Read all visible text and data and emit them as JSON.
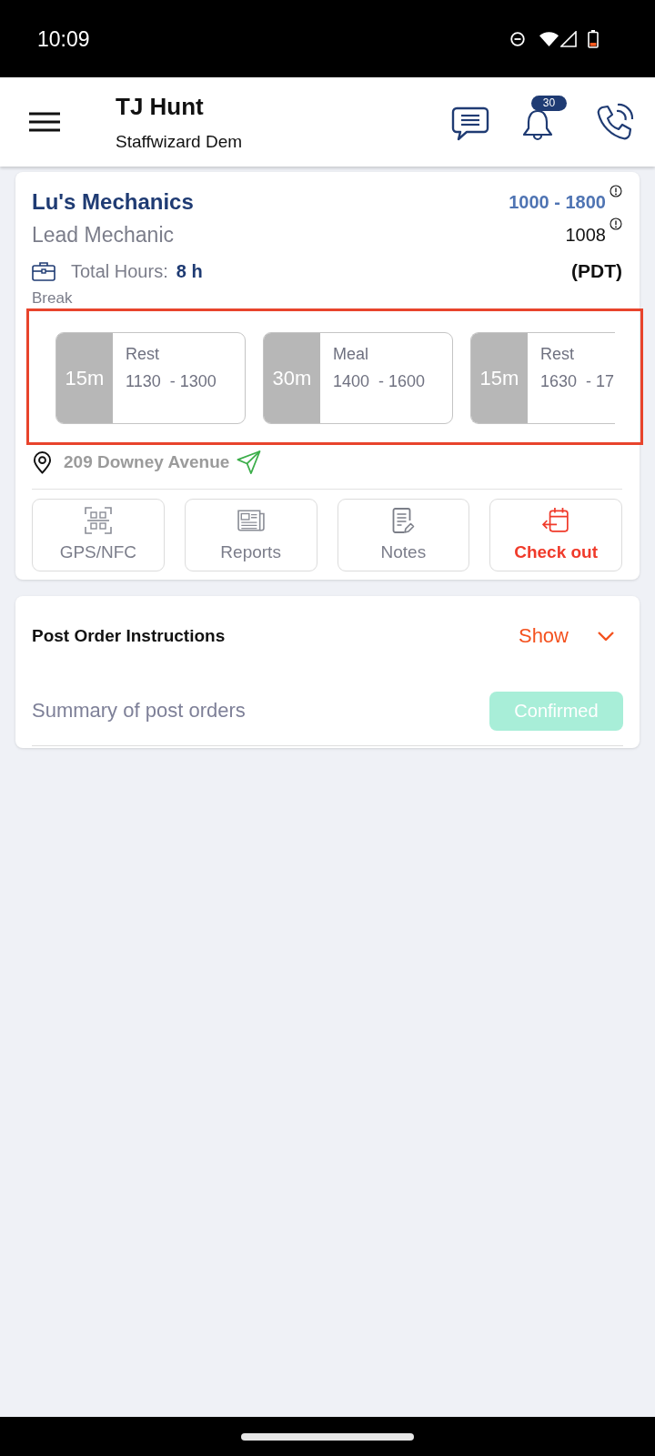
{
  "status_bar": {
    "time": "10:09"
  },
  "header": {
    "title": "TJ Hunt",
    "subtitle": "Staffwizard Dem",
    "notification_count": "30"
  },
  "shift_card": {
    "site": "Lu's Mechanics",
    "time_range": "1000 - 1800",
    "position": "Lead Mechanic",
    "code": "1008",
    "total_hours_label": "Total Hours:",
    "total_hours": "8 h",
    "timezone": "(PDT)",
    "break_section": {
      "label": "Break",
      "highlighted": true,
      "breaks": [
        {
          "duration": "15m",
          "type": "Rest",
          "time": "1130  - 1300"
        },
        {
          "duration": "30m",
          "type": "Meal",
          "time": "1400  - 1600"
        },
        {
          "duration": "15m",
          "type": "Rest",
          "time": "1630  - 17"
        }
      ]
    },
    "address": "209 Downey Avenue",
    "actions": [
      {
        "kind": "gps",
        "label": "GPS/NFC"
      },
      {
        "kind": "reports",
        "label": "Reports"
      },
      {
        "kind": "notes",
        "label": "Notes"
      },
      {
        "kind": "checkout",
        "label": "Check out"
      }
    ]
  },
  "post_orders": {
    "title": "Post Order Instructions",
    "toggle": "Show",
    "summary": "Summary of post orders",
    "status": "Confirmed"
  }
}
